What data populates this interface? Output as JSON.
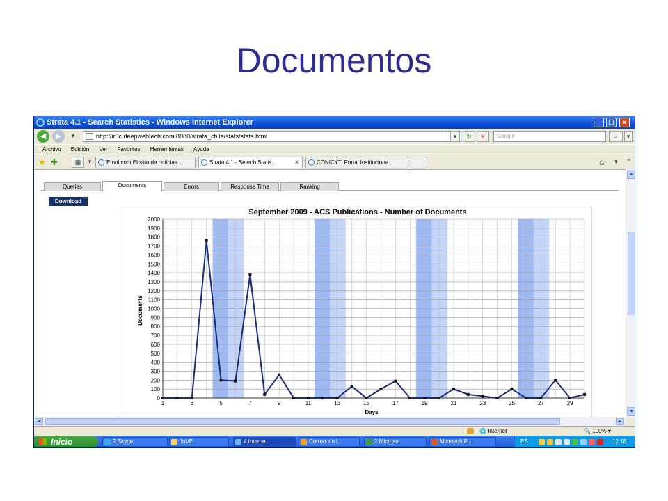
{
  "slide": {
    "title": "Documentos"
  },
  "browser": {
    "window_title": "Strata 4.1 - Search Statistics - Windows Internet Explorer",
    "address": "http://ir6c.deepwebtech.com:8080/strata_chile/stats/stats.html",
    "search_placeholder": "Google",
    "menu": [
      "Archivo",
      "Edición",
      "Ver",
      "Favoritos",
      "Herramientas",
      "Ayuda"
    ],
    "tabs": [
      {
        "label": "Emol.com El sitio de noticias ...",
        "active": false
      },
      {
        "label": "Strata 4.1 - Search Statis...",
        "active": true
      },
      {
        "label": "CONICYT. Portal Instituciona...",
        "active": false
      }
    ],
    "status": {
      "zone": "Internet",
      "zoom": "100%"
    }
  },
  "app": {
    "tabs": [
      {
        "label": "Queries"
      },
      {
        "label": "Documents",
        "selected": true
      },
      {
        "label": "Errors"
      },
      {
        "label": "Response Time"
      },
      {
        "label": "Ranking"
      }
    ],
    "download_label": "Download"
  },
  "taskbar": {
    "start_label": "Inicio",
    "items": [
      "2 Skype",
      "JoVE",
      "4 Interne...",
      "Correo sin l...",
      "2 Microso...",
      "Microsoft P..."
    ],
    "lang": "ES",
    "clock": "12:18"
  },
  "colors": {
    "series": "#1a2a80",
    "weekend": "#a8c0f4",
    "title": "#2e2c8e"
  },
  "chart_data": {
    "type": "line",
    "title": "September 2009 - ACS Publications - Number of Documents",
    "xlabel": "Days",
    "ylabel": "Documents",
    "xlim": [
      1,
      30
    ],
    "ylim": [
      0,
      2000
    ],
    "yticks": [
      0,
      100,
      200,
      300,
      400,
      500,
      600,
      700,
      800,
      900,
      1000,
      1100,
      1200,
      1300,
      1400,
      1500,
      1600,
      1700,
      1800,
      1900,
      2000
    ],
    "xticks": [
      1,
      3,
      5,
      7,
      9,
      11,
      13,
      15,
      17,
      19,
      21,
      23,
      25,
      27,
      29
    ],
    "grid": true,
    "weekend_bands": [
      [
        5,
        6
      ],
      [
        12,
        13
      ],
      [
        19,
        20
      ],
      [
        26,
        27
      ]
    ],
    "series": [
      {
        "x": [
          1,
          2,
          3,
          4,
          5,
          6,
          7,
          8,
          9,
          10,
          11,
          12,
          13,
          14,
          15,
          16,
          17,
          18,
          19,
          20,
          21,
          22,
          23,
          24,
          25,
          26,
          27,
          28,
          29,
          30
        ],
        "values": [
          0,
          0,
          0,
          1760,
          200,
          190,
          1380,
          40,
          260,
          0,
          0,
          0,
          0,
          130,
          0,
          100,
          190,
          0,
          0,
          0,
          100,
          40,
          20,
          0,
          100,
          0,
          0,
          200,
          0,
          40
        ]
      }
    ]
  }
}
